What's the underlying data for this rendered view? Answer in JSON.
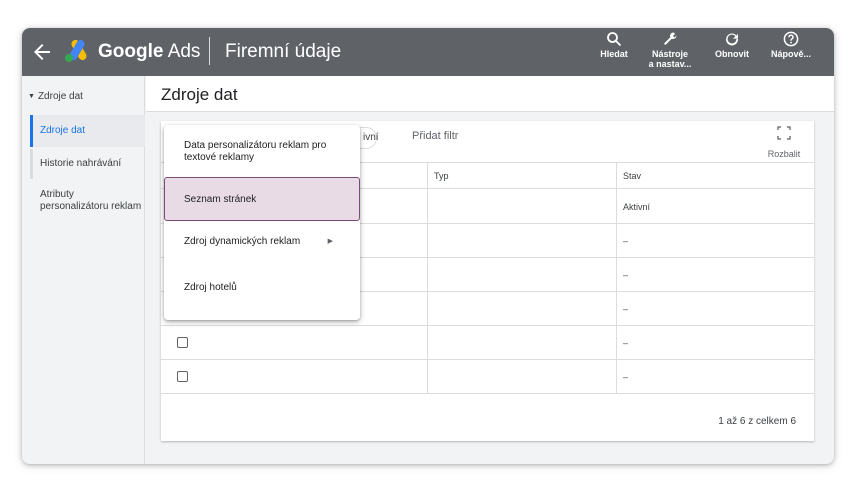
{
  "header": {
    "app_name_bold": "Google",
    "app_name_rest": "Ads",
    "page_title": "Firemní údaje",
    "buttons": {
      "search": "Hledat",
      "tools_line1": "Nástroje",
      "tools_line2": "a nastav...",
      "refresh": "Obnovit",
      "help": "Nápově..."
    },
    "icons": {
      "back": "arrow-back-icon",
      "logo": "google-ads-logo",
      "search": "search-icon",
      "tools": "wrench-icon",
      "refresh": "refresh-icon",
      "help": "help-icon"
    }
  },
  "sidebar": {
    "parent": "Zdroje dat",
    "items": [
      {
        "label": "Zdroje dat",
        "active": true
      },
      {
        "label": "Historie nahrávání",
        "active": false
      },
      {
        "label": "Atributy personalizátoru reklam",
        "active": false
      }
    ]
  },
  "main": {
    "title": "Zdroje dat",
    "filter_chip": "ivní",
    "add_filter": "Přidat filtr",
    "expand": "Rozbalit",
    "columns": [
      "Typ",
      "Stav"
    ],
    "rows": [
      {
        "status": "Aktivní"
      },
      {
        "status": "–"
      },
      {
        "status": "–"
      },
      {
        "status": "–"
      },
      {
        "status": "–"
      },
      {
        "status": "–"
      }
    ],
    "pager": "1 až 6 z celkem 6"
  },
  "menu": {
    "items": [
      "Data personalizátoru reklam pro textové reklamy",
      "Seznam stránek",
      "Zdroj dynamických reklam",
      "Zdroj hotelů"
    ]
  },
  "colors": {
    "header_bg": "#5f6368",
    "accent": "#1a73e8",
    "highlight_bg": "#e9dbe6",
    "highlight_border": "#7a4a79"
  }
}
